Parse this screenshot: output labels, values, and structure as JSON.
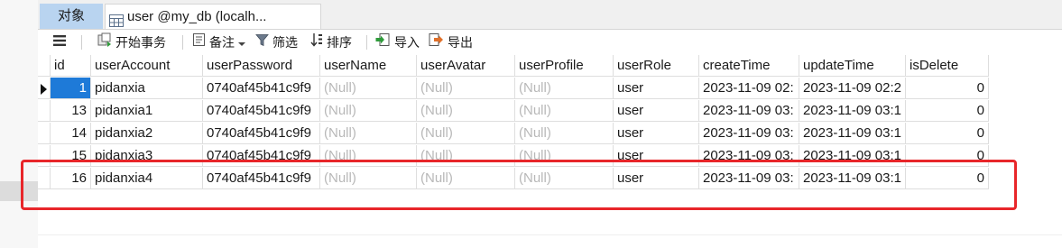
{
  "tabs": [
    {
      "label": "对象"
    },
    {
      "label": "user @my_db (localh..."
    }
  ],
  "toolbar": {
    "begin_transaction": "开始事务",
    "note": "备注",
    "filter": "筛选",
    "sort": "排序",
    "import": "导入",
    "export": "导出"
  },
  "table": {
    "columns": [
      "id",
      "userAccount",
      "userPassword",
      "userName",
      "userAvatar",
      "userProfile",
      "userRole",
      "createTime",
      "updateTime",
      "isDelete"
    ],
    "rows": [
      {
        "id": "1",
        "userAccount": "pidanxia",
        "userPassword": "0740af45b41c9f9",
        "userName": "(Null)",
        "userAvatar": "(Null)",
        "userProfile": "(Null)",
        "userRole": "user",
        "createTime": "2023-11-09 02:",
        "updateTime": "2023-11-09 02:2",
        "isDelete": "0"
      },
      {
        "id": "13",
        "userAccount": "pidanxia1",
        "userPassword": "0740af45b41c9f9",
        "userName": "(Null)",
        "userAvatar": "(Null)",
        "userProfile": "(Null)",
        "userRole": "user",
        "createTime": "2023-11-09 03:",
        "updateTime": "2023-11-09 03:1",
        "isDelete": "0"
      },
      {
        "id": "14",
        "userAccount": "pidanxia2",
        "userPassword": "0740af45b41c9f9",
        "userName": "(Null)",
        "userAvatar": "(Null)",
        "userProfile": "(Null)",
        "userRole": "user",
        "createTime": "2023-11-09 03:",
        "updateTime": "2023-11-09 03:1",
        "isDelete": "0"
      },
      {
        "id": "15",
        "userAccount": "pidanxia3",
        "userPassword": "0740af45b41c9f9",
        "userName": "(Null)",
        "userAvatar": "(Null)",
        "userProfile": "(Null)",
        "userRole": "user",
        "createTime": "2023-11-09 03:",
        "updateTime": "2023-11-09 03:1",
        "isDelete": "0"
      },
      {
        "id": "16",
        "userAccount": "pidanxia4",
        "userPassword": "0740af45b41c9f9",
        "userName": "(Null)",
        "userAvatar": "(Null)",
        "userProfile": "(Null)",
        "userRole": "user",
        "createTime": "2023-11-09 03:",
        "updateTime": "2023-11-09 03:1",
        "isDelete": "0"
      }
    ]
  },
  "colors": {
    "selected_cell": "#1e7ad8",
    "highlight_box": "#e8262a",
    "null_text": "#b8b8b8",
    "objects_tab": "#b9d4f0"
  },
  "icons": [
    "menu-icon",
    "begin-transaction-icon",
    "note-icon",
    "dropdown-arrow-icon",
    "filter-icon",
    "sort-icon",
    "import-icon",
    "export-icon",
    "table-grid-icon",
    "current-row-arrow-icon"
  ]
}
